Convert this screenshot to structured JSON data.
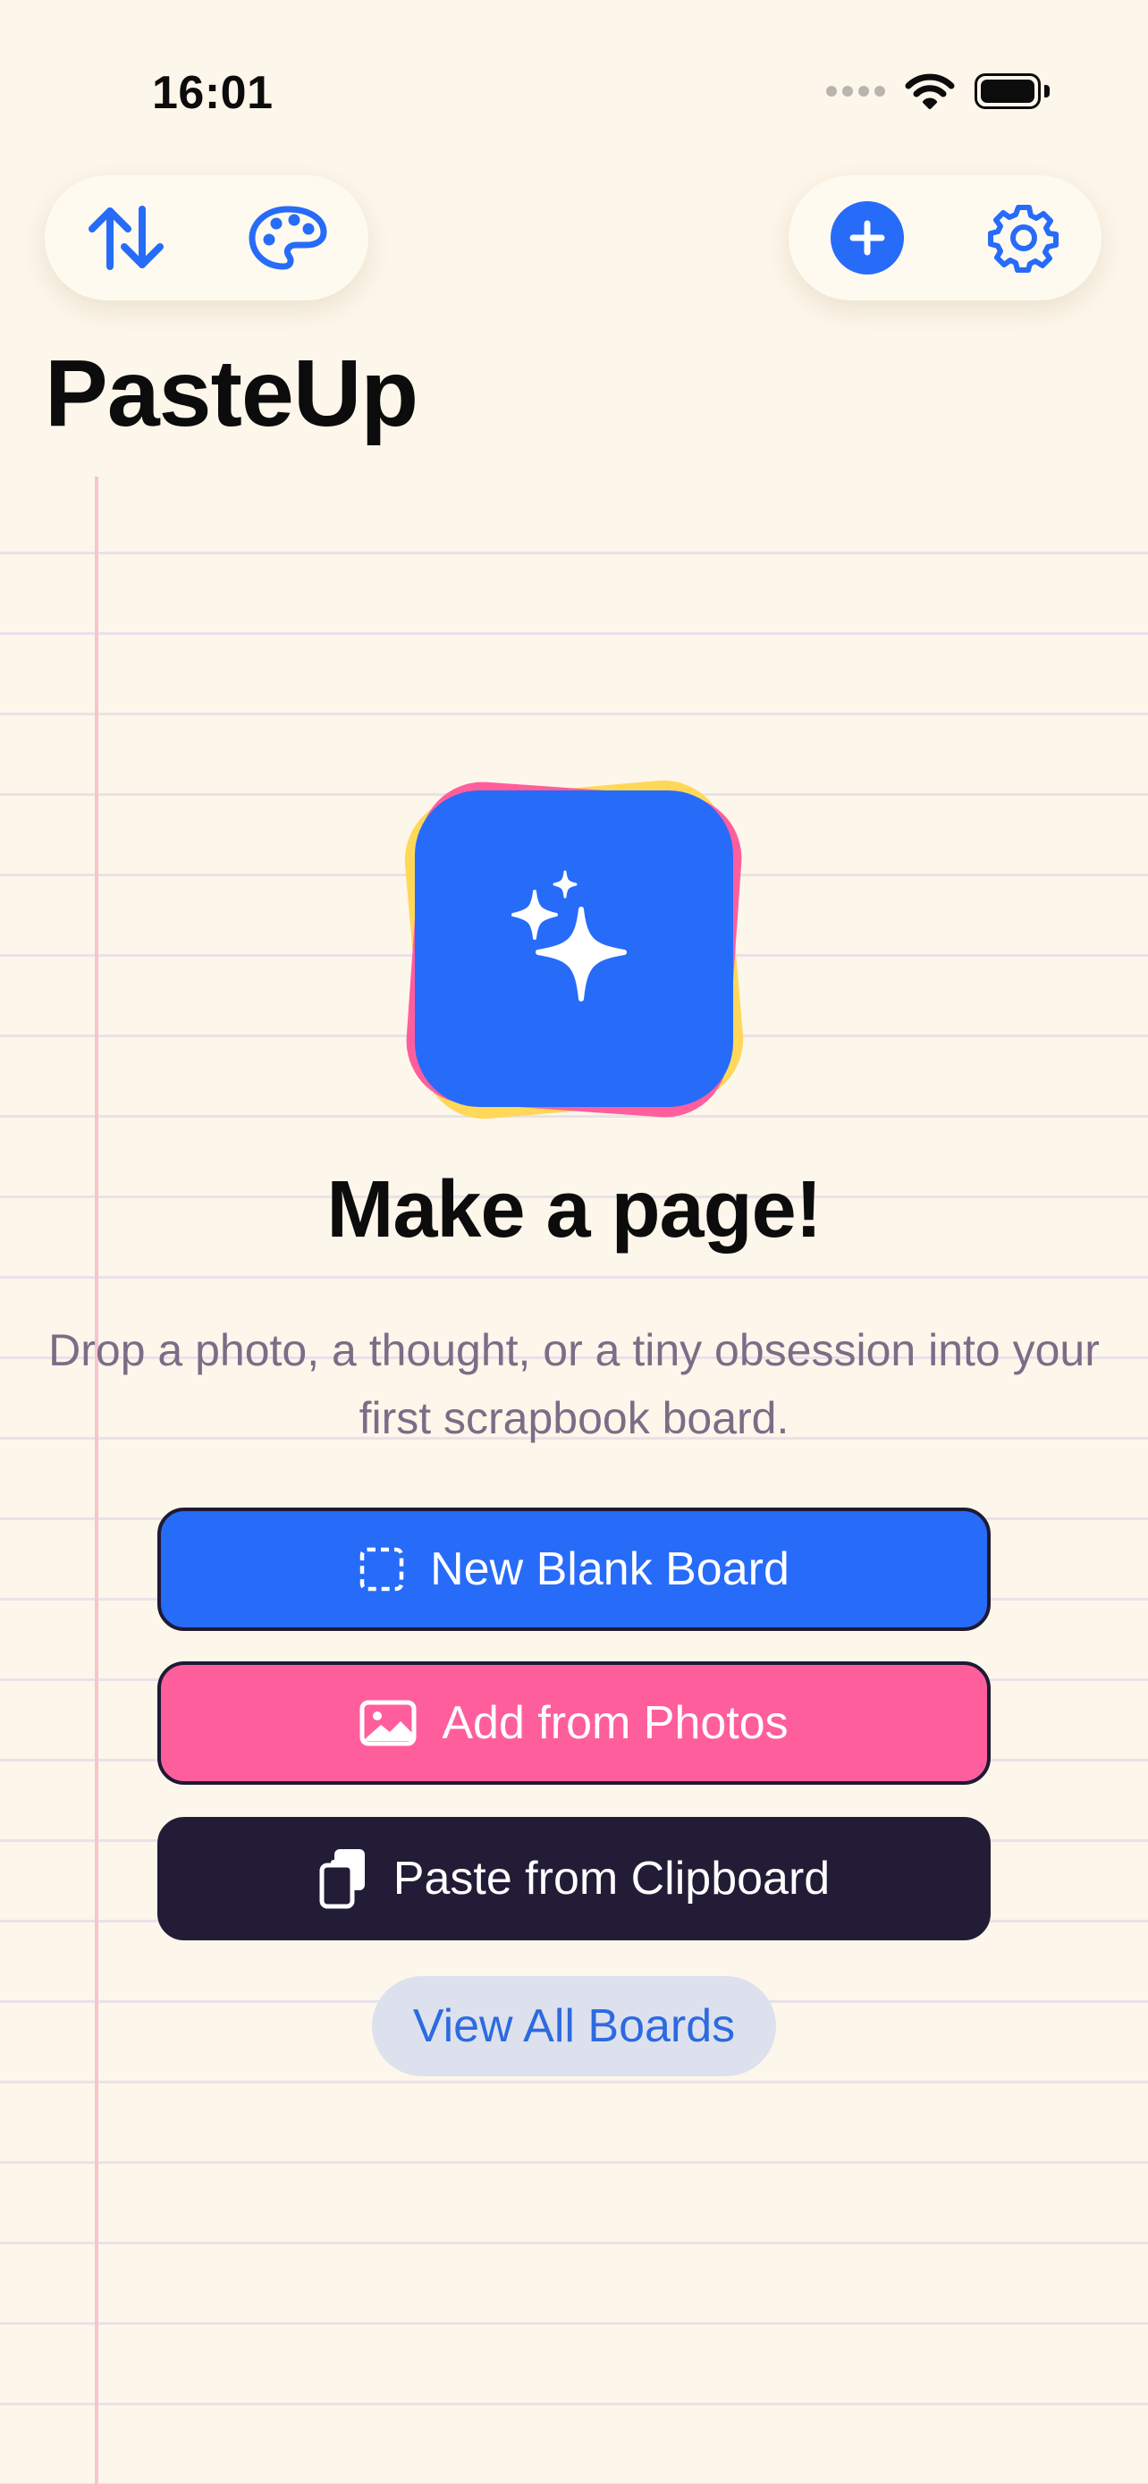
{
  "status_bar": {
    "time": "16:01"
  },
  "toolbar": {
    "left": [
      {
        "name": "sort",
        "icon": "arrow-up-down-icon"
      },
      {
        "name": "theme",
        "icon": "palette-icon"
      }
    ],
    "right": [
      {
        "name": "add",
        "icon": "plus-circle-icon"
      },
      {
        "name": "settings",
        "icon": "gear-icon"
      }
    ]
  },
  "app": {
    "title": "PasteUp"
  },
  "empty_state": {
    "icon": "sparkles-icon",
    "headline": "Make a page!",
    "subtext": "Drop a photo, a thought, or a tiny obsession into your first scrapbook board."
  },
  "actions": {
    "new_blank": {
      "label": "New Blank Board",
      "icon": "dashed-square-icon"
    },
    "add_photos": {
      "label": "Add from Photos",
      "icon": "photo-icon"
    },
    "paste_clipboard": {
      "label": "Paste from Clipboard",
      "icon": "clipboard-paste-icon"
    },
    "view_all": {
      "label": "View All Boards"
    }
  },
  "colors": {
    "background": "#fdf6ea",
    "accent_blue": "#276bf9",
    "accent_pink": "#ff5e9d",
    "accent_yellow": "#ffd85a",
    "dark": "#221c36",
    "subtext": "#7d6c87",
    "margin_line": "#f4c6cf"
  }
}
